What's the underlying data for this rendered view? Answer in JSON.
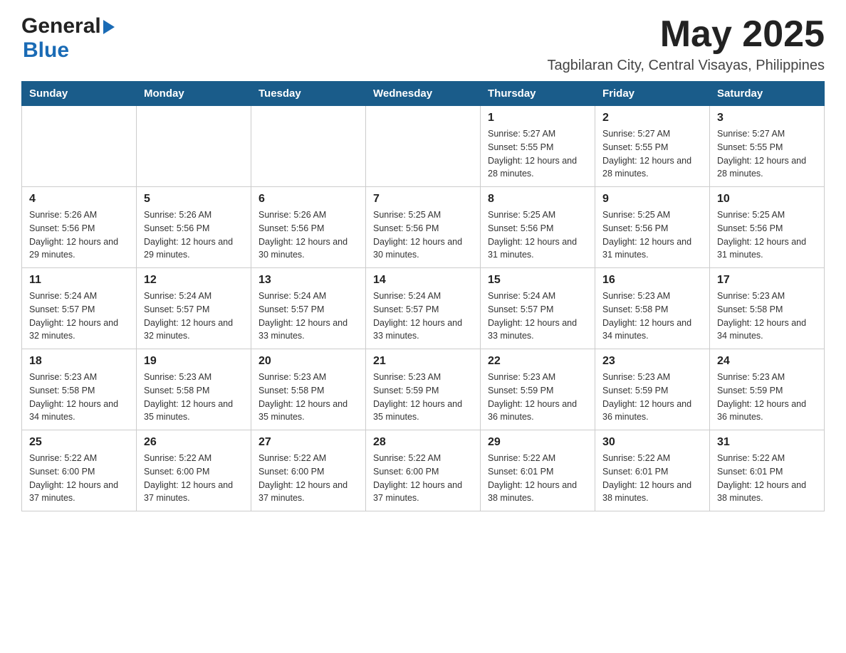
{
  "header": {
    "logo_general": "General",
    "logo_blue": "Blue",
    "month_title": "May 2025",
    "subtitle": "Tagbilaran City, Central Visayas, Philippines"
  },
  "calendar": {
    "days_of_week": [
      "Sunday",
      "Monday",
      "Tuesday",
      "Wednesday",
      "Thursday",
      "Friday",
      "Saturday"
    ],
    "weeks": [
      [
        {
          "day": "",
          "info": ""
        },
        {
          "day": "",
          "info": ""
        },
        {
          "day": "",
          "info": ""
        },
        {
          "day": "",
          "info": ""
        },
        {
          "day": "1",
          "info": "Sunrise: 5:27 AM\nSunset: 5:55 PM\nDaylight: 12 hours and 28 minutes."
        },
        {
          "day": "2",
          "info": "Sunrise: 5:27 AM\nSunset: 5:55 PM\nDaylight: 12 hours and 28 minutes."
        },
        {
          "day": "3",
          "info": "Sunrise: 5:27 AM\nSunset: 5:55 PM\nDaylight: 12 hours and 28 minutes."
        }
      ],
      [
        {
          "day": "4",
          "info": "Sunrise: 5:26 AM\nSunset: 5:56 PM\nDaylight: 12 hours and 29 minutes."
        },
        {
          "day": "5",
          "info": "Sunrise: 5:26 AM\nSunset: 5:56 PM\nDaylight: 12 hours and 29 minutes."
        },
        {
          "day": "6",
          "info": "Sunrise: 5:26 AM\nSunset: 5:56 PM\nDaylight: 12 hours and 30 minutes."
        },
        {
          "day": "7",
          "info": "Sunrise: 5:25 AM\nSunset: 5:56 PM\nDaylight: 12 hours and 30 minutes."
        },
        {
          "day": "8",
          "info": "Sunrise: 5:25 AM\nSunset: 5:56 PM\nDaylight: 12 hours and 31 minutes."
        },
        {
          "day": "9",
          "info": "Sunrise: 5:25 AM\nSunset: 5:56 PM\nDaylight: 12 hours and 31 minutes."
        },
        {
          "day": "10",
          "info": "Sunrise: 5:25 AM\nSunset: 5:56 PM\nDaylight: 12 hours and 31 minutes."
        }
      ],
      [
        {
          "day": "11",
          "info": "Sunrise: 5:24 AM\nSunset: 5:57 PM\nDaylight: 12 hours and 32 minutes."
        },
        {
          "day": "12",
          "info": "Sunrise: 5:24 AM\nSunset: 5:57 PM\nDaylight: 12 hours and 32 minutes."
        },
        {
          "day": "13",
          "info": "Sunrise: 5:24 AM\nSunset: 5:57 PM\nDaylight: 12 hours and 33 minutes."
        },
        {
          "day": "14",
          "info": "Sunrise: 5:24 AM\nSunset: 5:57 PM\nDaylight: 12 hours and 33 minutes."
        },
        {
          "day": "15",
          "info": "Sunrise: 5:24 AM\nSunset: 5:57 PM\nDaylight: 12 hours and 33 minutes."
        },
        {
          "day": "16",
          "info": "Sunrise: 5:23 AM\nSunset: 5:58 PM\nDaylight: 12 hours and 34 minutes."
        },
        {
          "day": "17",
          "info": "Sunrise: 5:23 AM\nSunset: 5:58 PM\nDaylight: 12 hours and 34 minutes."
        }
      ],
      [
        {
          "day": "18",
          "info": "Sunrise: 5:23 AM\nSunset: 5:58 PM\nDaylight: 12 hours and 34 minutes."
        },
        {
          "day": "19",
          "info": "Sunrise: 5:23 AM\nSunset: 5:58 PM\nDaylight: 12 hours and 35 minutes."
        },
        {
          "day": "20",
          "info": "Sunrise: 5:23 AM\nSunset: 5:58 PM\nDaylight: 12 hours and 35 minutes."
        },
        {
          "day": "21",
          "info": "Sunrise: 5:23 AM\nSunset: 5:59 PM\nDaylight: 12 hours and 35 minutes."
        },
        {
          "day": "22",
          "info": "Sunrise: 5:23 AM\nSunset: 5:59 PM\nDaylight: 12 hours and 36 minutes."
        },
        {
          "day": "23",
          "info": "Sunrise: 5:23 AM\nSunset: 5:59 PM\nDaylight: 12 hours and 36 minutes."
        },
        {
          "day": "24",
          "info": "Sunrise: 5:23 AM\nSunset: 5:59 PM\nDaylight: 12 hours and 36 minutes."
        }
      ],
      [
        {
          "day": "25",
          "info": "Sunrise: 5:22 AM\nSunset: 6:00 PM\nDaylight: 12 hours and 37 minutes."
        },
        {
          "day": "26",
          "info": "Sunrise: 5:22 AM\nSunset: 6:00 PM\nDaylight: 12 hours and 37 minutes."
        },
        {
          "day": "27",
          "info": "Sunrise: 5:22 AM\nSunset: 6:00 PM\nDaylight: 12 hours and 37 minutes."
        },
        {
          "day": "28",
          "info": "Sunrise: 5:22 AM\nSunset: 6:00 PM\nDaylight: 12 hours and 37 minutes."
        },
        {
          "day": "29",
          "info": "Sunrise: 5:22 AM\nSunset: 6:01 PM\nDaylight: 12 hours and 38 minutes."
        },
        {
          "day": "30",
          "info": "Sunrise: 5:22 AM\nSunset: 6:01 PM\nDaylight: 12 hours and 38 minutes."
        },
        {
          "day": "31",
          "info": "Sunrise: 5:22 AM\nSunset: 6:01 PM\nDaylight: 12 hours and 38 minutes."
        }
      ]
    ]
  }
}
